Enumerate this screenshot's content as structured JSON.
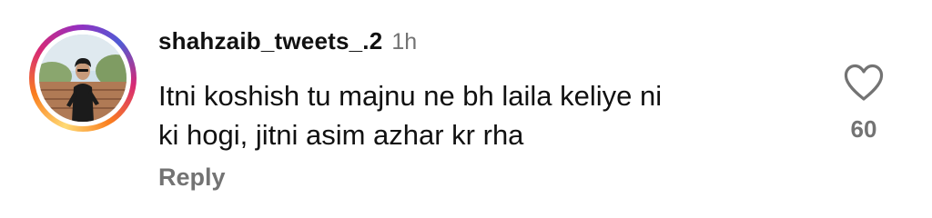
{
  "comment": {
    "username": "shahzaib_tweets_.2",
    "timestamp": "1h",
    "text_lines": [
      "Itni koshish tu majnu ne bh laila keliye ni",
      "ki hogi, jitni asim azhar kr rha"
    ],
    "reply_label": "Reply",
    "like_count": "60"
  },
  "icons": {
    "like": "heart-outline-icon",
    "avatar": "user-avatar-photo"
  },
  "colors": {
    "text_primary": "#111111",
    "text_secondary": "#737373",
    "story_ring": [
      "#feda75",
      "#fa7e1e",
      "#d62976",
      "#962fbf",
      "#4f5bd5"
    ]
  }
}
